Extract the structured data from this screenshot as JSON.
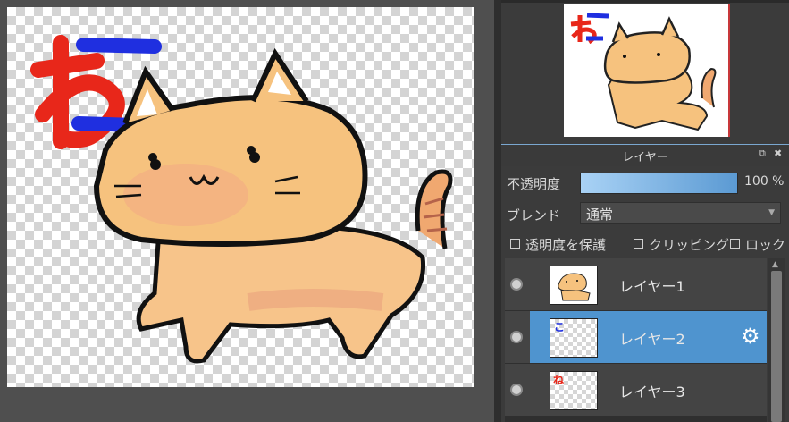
{
  "navigator": {
    "thumbnail": "navigator-preview"
  },
  "layer_panel": {
    "title": "レイヤー",
    "opacity_label": "不透明度",
    "opacity_value": "100 %",
    "opacity_level": 1.0,
    "blend_label": "ブレンド",
    "blend_value": "通常",
    "checkboxes": {
      "protect_alpha": "透明度を保護",
      "clipping": "クリッピング",
      "lock": "ロック"
    },
    "layers": [
      {
        "name": "レイヤー1",
        "visible": true,
        "selected": false
      },
      {
        "name": "レイヤー2",
        "visible": true,
        "selected": true
      },
      {
        "name": "レイヤー3",
        "visible": true,
        "selected": false
      }
    ],
    "accent_color": "#4f94cf"
  },
  "canvas": {
    "glyph_red": "ね",
    "glyph_blue": "こ"
  }
}
